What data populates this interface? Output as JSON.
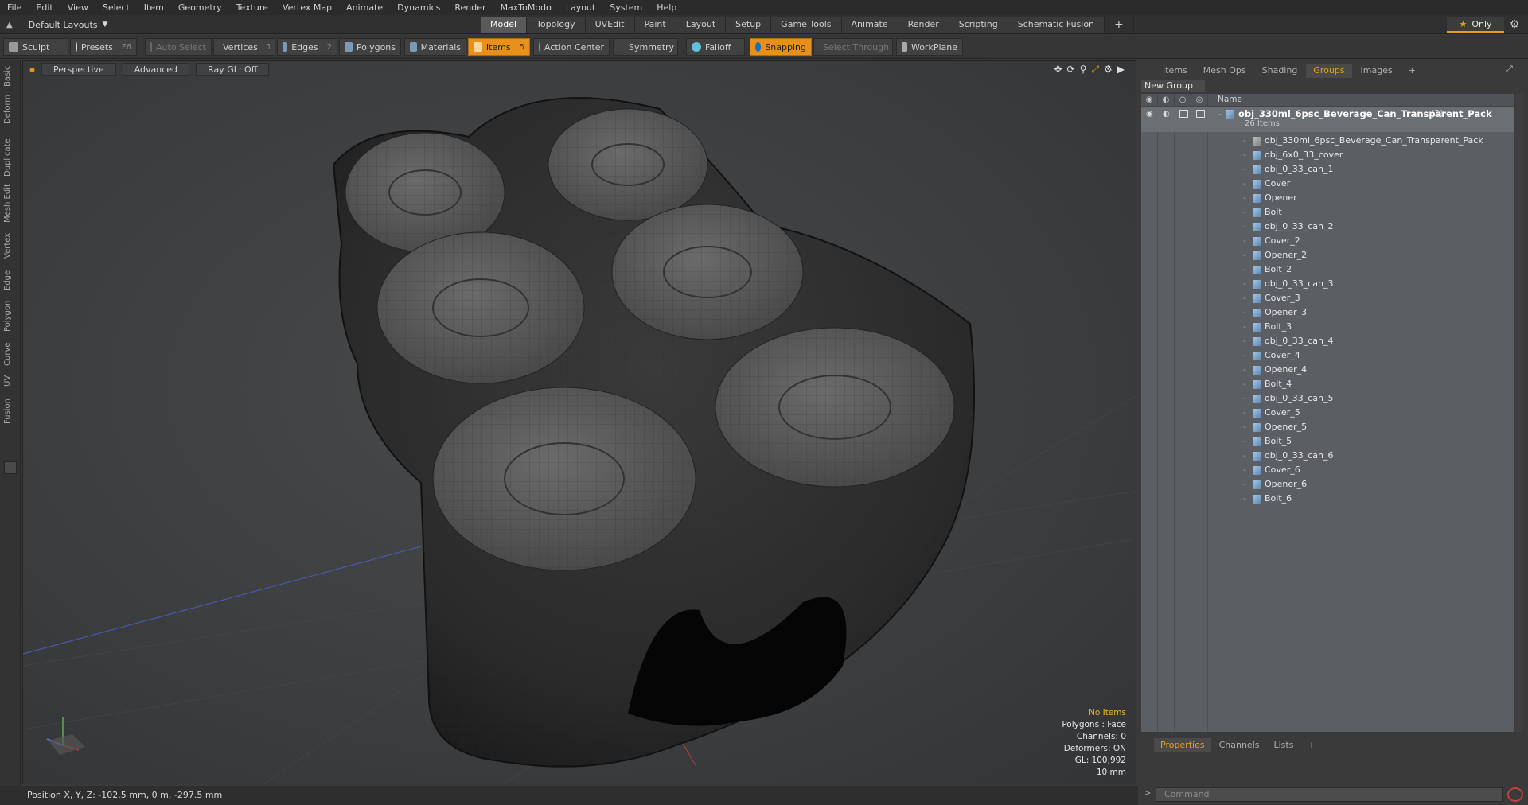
{
  "menu": [
    "File",
    "Edit",
    "View",
    "Select",
    "Item",
    "Geometry",
    "Texture",
    "Vertex Map",
    "Animate",
    "Dynamics",
    "Render",
    "MaxToModo",
    "Layout",
    "System",
    "Help"
  ],
  "layout_select": "Default Layouts",
  "tabs": [
    "Model",
    "Topology",
    "UVEdit",
    "Paint",
    "Layout",
    "Setup",
    "Game Tools",
    "Animate",
    "Render",
    "Scripting",
    "Schematic Fusion"
  ],
  "tabs_add": "+",
  "only_label": "Only",
  "toolbar": {
    "sculpt": "Sculpt",
    "presets": "Presets",
    "presets_key": "F6",
    "auto_select": "Auto Select",
    "vertices": "Vertices",
    "vertices_key": "1",
    "edges": "Edges",
    "edges_key": "2",
    "polygons": "Polygons",
    "materials": "Materials",
    "items": "Items",
    "items_key": "5",
    "action_center": "Action Center",
    "symmetry": "Symmetry",
    "falloff": "Falloff",
    "snapping": "Snapping",
    "select_through": "Select Through",
    "workplane": "WorkPlane"
  },
  "left_tabs": [
    "Basic",
    "Deform",
    "Duplicate",
    "Mesh Edit",
    "Vertex",
    "Edge",
    "Polygon",
    "Curve",
    "UV",
    "Fusion"
  ],
  "viewport": {
    "perspective": "Perspective",
    "advanced": "Advanced",
    "raygl": "Ray GL: Off",
    "stats": {
      "items": "No Items",
      "polygons": "Polygons : Face",
      "channels": "Channels: 0",
      "deformers": "Deformers: ON",
      "gl": "GL: 100,992",
      "scale": "10 mm"
    }
  },
  "status": "Position X, Y, Z:   -102.5 mm, 0 m, -297.5 mm",
  "right_tabs": [
    "Items",
    "Mesh Ops",
    "Shading",
    "Groups",
    "Images"
  ],
  "right_tabs_add": "+",
  "new_group": "New Group",
  "list_header_name": "Name",
  "group": {
    "name": "obj_330ml_6psc_Beverage_Can_Transparent_Pack",
    "count": "(2) :",
    "sub": "26 Items"
  },
  "items": [
    "obj_330ml_6psc_Beverage_Can_Transparent_Pack",
    "obj_6x0_33_cover",
    "obj_0_33_can_1",
    "Cover",
    "Opener",
    "Bolt",
    "obj_0_33_can_2",
    "Cover_2",
    "Opener_2",
    "Bolt_2",
    "obj_0_33_can_3",
    "Cover_3",
    "Opener_3",
    "Bolt_3",
    "obj_0_33_can_4",
    "Cover_4",
    "Opener_4",
    "Bolt_4",
    "obj_0_33_can_5",
    "Cover_5",
    "Opener_5",
    "Bolt_5",
    "obj_0_33_can_6",
    "Cover_6",
    "Opener_6",
    "Bolt_6"
  ],
  "bottom_tabs": [
    "Properties",
    "Channels",
    "Lists"
  ],
  "bottom_tabs_add": "+",
  "command_placeholder": "Command",
  "colors": {
    "accent": "#e8901a",
    "list_bg": "#5b5f63",
    "viewport_bg": "#3c3e40"
  }
}
